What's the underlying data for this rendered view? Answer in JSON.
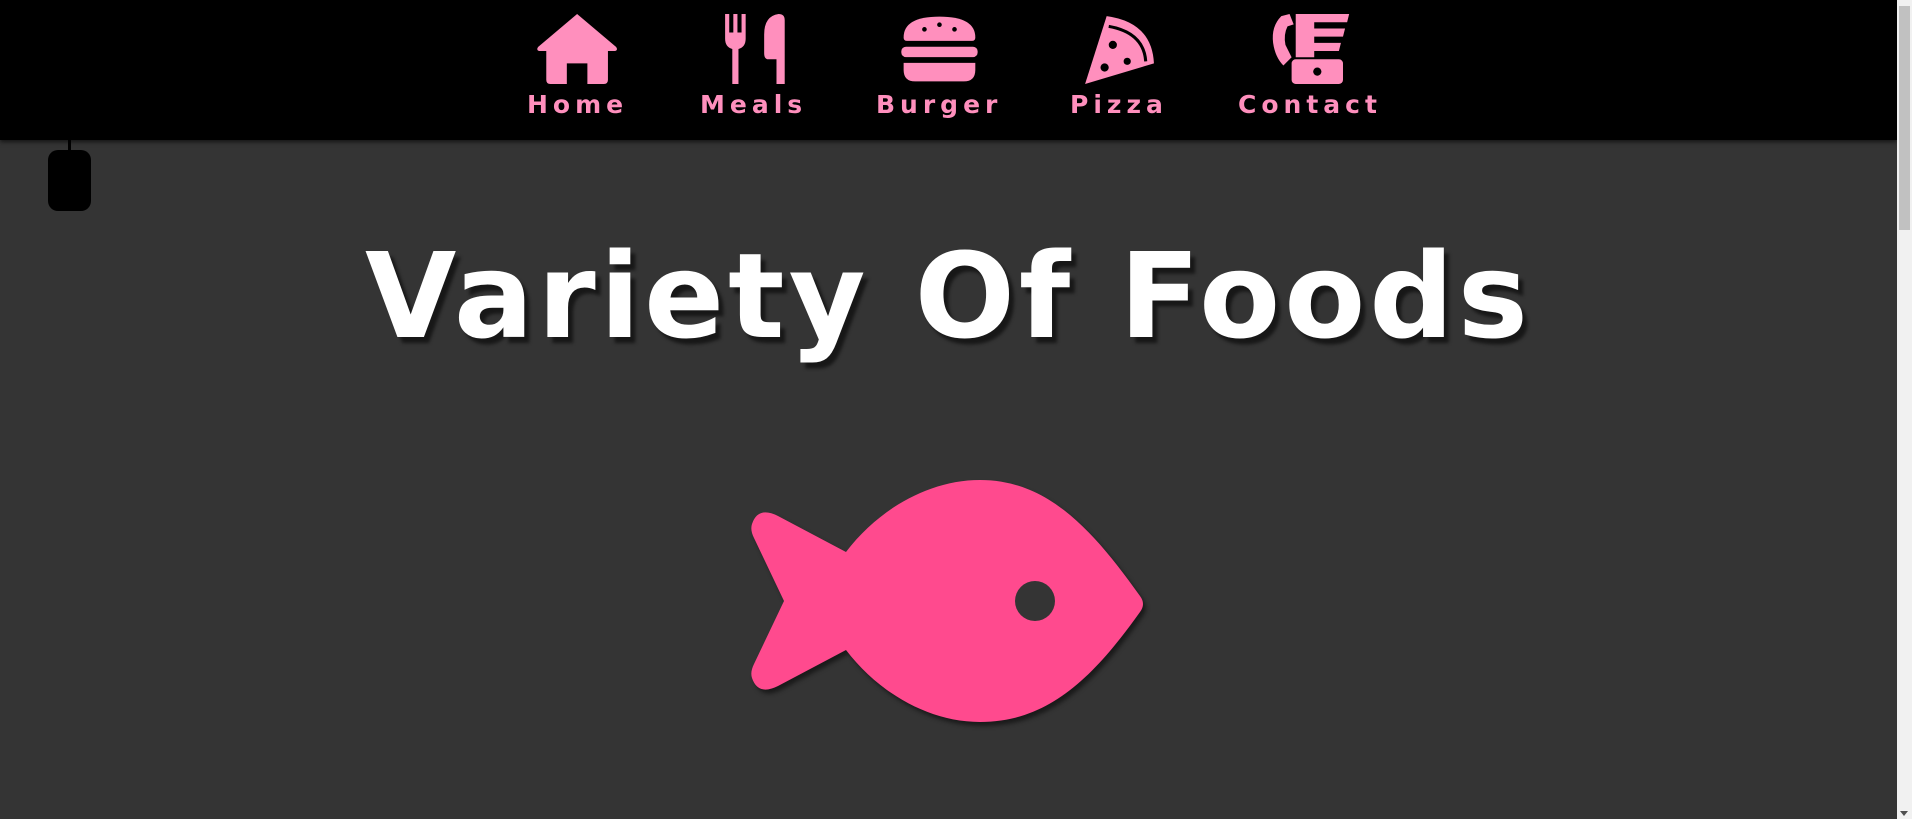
{
  "colors": {
    "navbar_bg": "#000000",
    "page_bg": "#343434",
    "nav_accent": "#ff8fbd",
    "fish_accent": "#ff4a8e",
    "title_color": "#ffffff"
  },
  "nav": {
    "items": [
      {
        "label": "Home",
        "icon": "house-icon"
      },
      {
        "label": "Meals",
        "icon": "utensils-icon"
      },
      {
        "label": "Burger",
        "icon": "burger-icon"
      },
      {
        "label": "Pizza",
        "icon": "pizza-slice-icon"
      },
      {
        "label": "Contact",
        "icon": "phone-fax-icon"
      }
    ]
  },
  "hero": {
    "title": "Variety Of Foods",
    "icon": "fish-icon"
  }
}
